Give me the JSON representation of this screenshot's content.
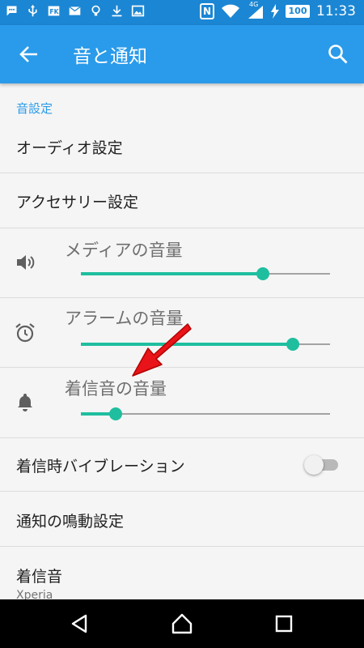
{
  "status": {
    "icons": [
      "chat-icon",
      "usb-icon",
      "fk-icon",
      "mail-icon",
      "bulb-icon",
      "download-icon",
      "image-icon"
    ],
    "nfc": "N",
    "signal": "4G",
    "battery": "100",
    "time": "11:33"
  },
  "appbar": {
    "title": "音と通知"
  },
  "settings": {
    "section_title": "音設定",
    "audio_settings": "オーディオ設定",
    "accessory_settings": "アクセサリー設定",
    "media_volume": {
      "label": "メディアの音量",
      "level": 0.73
    },
    "alarm_volume": {
      "label": "アラームの音量",
      "level": 0.85
    },
    "ringtone_volume": {
      "label": "着信音の音量",
      "level": 0.14
    },
    "vibrate_on_ring": {
      "label": "着信時バイブレーション",
      "on": false
    },
    "notification_vibration": "通知の鳴動設定",
    "ringtone": {
      "label": "着信音",
      "value": "Xperia"
    }
  },
  "colors": {
    "status_bar": "#1b86d3",
    "app_bar": "#2a9bea",
    "accent": "#1fbe9f",
    "arrow": "#e8141a"
  }
}
